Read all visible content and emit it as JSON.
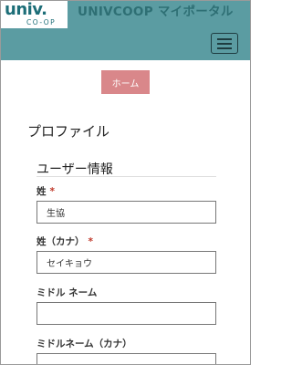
{
  "header": {
    "logo_text": "univ.",
    "logo_subtext": "CO-OP",
    "title": "UNIVCOOP マイポータル"
  },
  "nav": {
    "home_label": "ホーム"
  },
  "page": {
    "title": "プロファイル"
  },
  "section": {
    "title": "ユーザー情報"
  },
  "fields": [
    {
      "label": "姓",
      "required": true,
      "required_mark": "*",
      "value": "生協"
    },
    {
      "label": "姓（カナ）",
      "required": true,
      "required_mark": "*",
      "value": "セイキョウ"
    },
    {
      "label": "ミドル ネーム",
      "required": false,
      "value": ""
    },
    {
      "label": "ミドルネーム（カナ）",
      "required": false,
      "value": ""
    }
  ],
  "colors": {
    "header_bg": "#5b9ca2",
    "home_button_bg": "#d9878a",
    "required_mark": "#c0392b",
    "logo": "#1d6e78"
  },
  "icons": {
    "menu": "hamburger-menu-icon"
  }
}
